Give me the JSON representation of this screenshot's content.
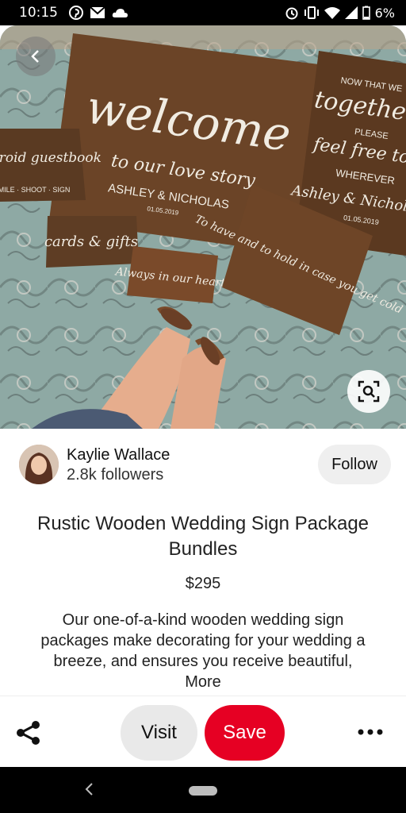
{
  "status_bar": {
    "time": "10:15",
    "battery_text": "6%",
    "icons_left": [
      "pinterest-icon",
      "gmail-icon",
      "cloud-icon"
    ],
    "icons_right": [
      "alarm-icon",
      "vibrate-icon",
      "wifi-icon",
      "signal-icon",
      "battery-icon"
    ]
  },
  "hero": {
    "signs": {
      "welcome": "welcome",
      "to_our": "to our love story",
      "names": "ASHLEY & NICHOLAS",
      "date": "01.05.2019",
      "polaroid": "polaroid guestbook",
      "smile": "SMILE · SHOOT · SIGN",
      "cards": "cards & gifts",
      "always": "Always in our hearts",
      "now": "NOW THAT WE",
      "together": "together",
      "please": "PLEASE",
      "feel": "feel free to",
      "wherever": "WHEREVER",
      "ashley": "Ashley & Nicholas",
      "date2": "01.05.2019",
      "tohave": "To have and to hold in case you get cold"
    }
  },
  "author": {
    "name": "Kaylie Wallace",
    "followers": "2.8k followers",
    "follow_label": "Follow"
  },
  "pin": {
    "title": "Rustic Wooden Wedding Sign Package Bundles",
    "price": "$295",
    "description": "Our one-of-a-kind wooden wedding sign packages make decorating for your wedding a breeze, and ensures you receive beautiful,",
    "more_label": "More"
  },
  "actions": {
    "visit_label": "Visit",
    "save_label": "Save"
  },
  "colors": {
    "save_red": "#e60023",
    "wood": "#6b4427",
    "rug": "#8aa7a2"
  }
}
